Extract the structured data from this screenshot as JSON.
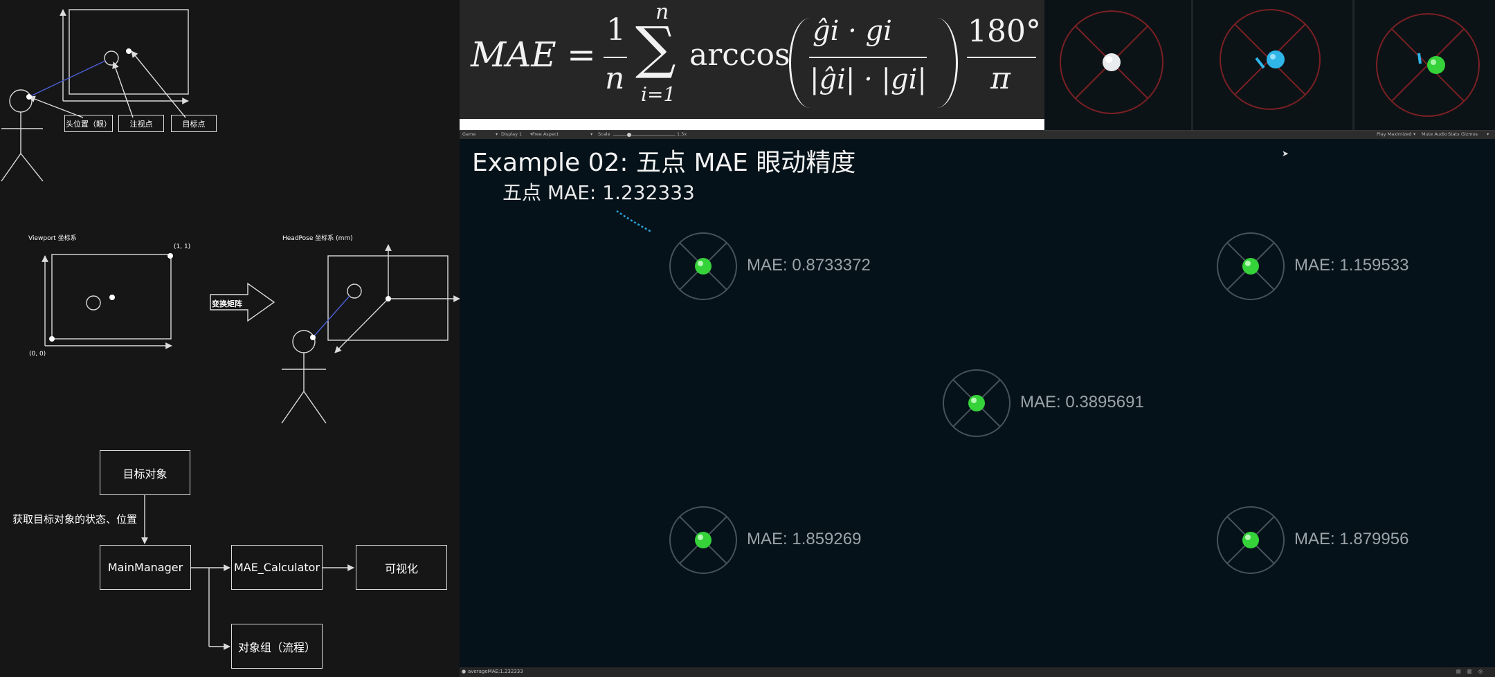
{
  "diagram1": {
    "head_label": "头位置（眼）",
    "gaze_label": "注视点",
    "target_label": "目标点"
  },
  "diagram2": {
    "viewport_title": "Viewport 坐标系",
    "corner_top": "(1, 1)",
    "corner_origin": "(0, 0)",
    "arrow_label": "变换矩阵",
    "headpose_title": "HeadPose 坐标系 (mm)"
  },
  "flowchart": {
    "target_object": "目标对象",
    "get_state_label": "获取目标对象的状态、位置",
    "main_manager": "MainManager",
    "mae_calculator": "MAE_Calculator",
    "visualize": "可视化",
    "object_group": "对象组（流程）"
  },
  "formula": {
    "lhs": "MAE",
    "equals": "=",
    "one": "1",
    "n": "n",
    "sum_top": "n",
    "sum": "∑",
    "sum_bottom": "i=1",
    "arccos": "arccos",
    "numerator": "ĝi · gi",
    "denominator": "|ĝi| · |gi|",
    "deg": "180°",
    "pi": "π"
  },
  "toolbar": {
    "game_tab": "Game",
    "display": "Display 1",
    "aspect": "Free Aspect",
    "scale_label": "Scale",
    "scale_value": "1.5x",
    "play_mode": "Play Maximized",
    "mute": "Mute Audio",
    "stats": "Stats",
    "gizmos": "Gizmos"
  },
  "game": {
    "title": "Example 02: 五点 MAE 眼动精度",
    "overall": "五点 MAE: 1.232333",
    "points": [
      {
        "id": "top-left",
        "mae": "MAE: 0.8733372"
      },
      {
        "id": "top-right",
        "mae": "MAE: 1.159533"
      },
      {
        "id": "center",
        "mae": "MAE: 0.3895691"
      },
      {
        "id": "bottom-left",
        "mae": "MAE: 1.859269"
      },
      {
        "id": "bottom-right",
        "mae": "MAE: 1.879956"
      }
    ]
  },
  "status": {
    "log": "averageMAE:1.232333"
  },
  "colors": {
    "sphere_green": "#35d23a",
    "sphere_blue": "#2fb5e8",
    "preview_ring": "#7a2024",
    "gaze_trail": "#2aa3d8"
  }
}
